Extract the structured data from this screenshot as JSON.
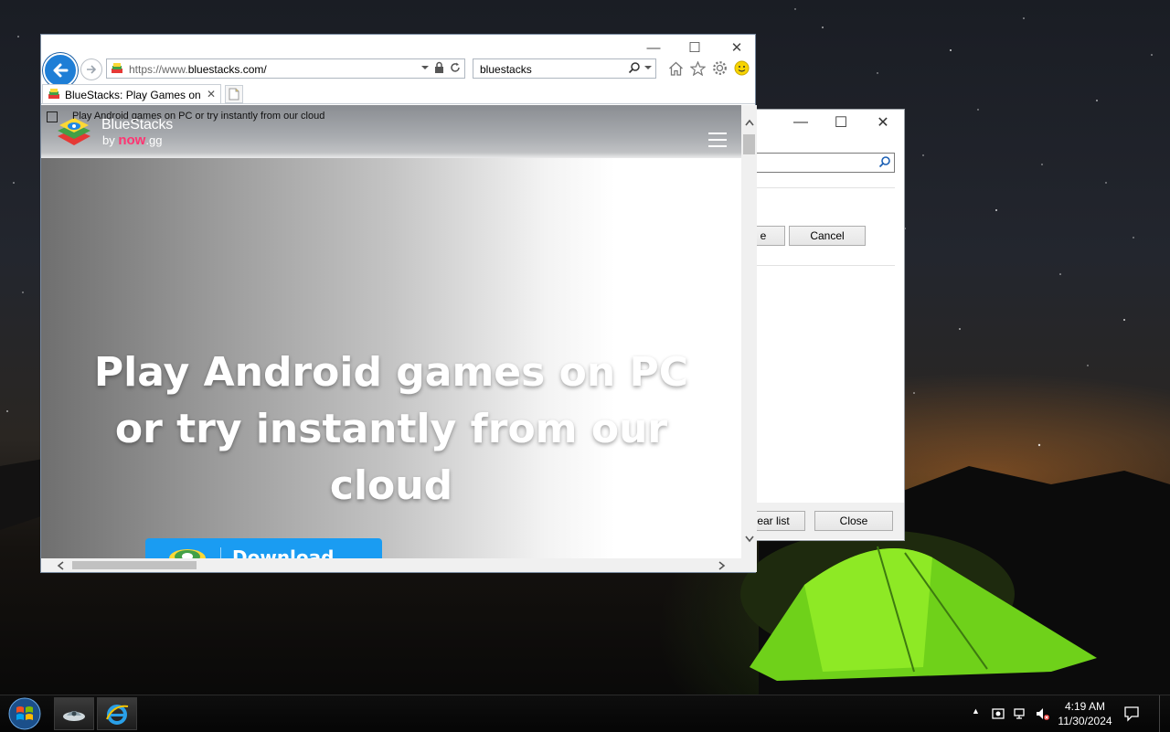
{
  "browser": {
    "url_prefix": "https://www.",
    "url_domain": "bluestacks.com/",
    "search_value": "bluestacks",
    "tab_title": "BlueStacks: Play Games on ...",
    "window_controls": {
      "minimize": "—",
      "maximize": "☐",
      "close": "✕"
    }
  },
  "page": {
    "broken_image_alt": "Play Android games on PC or try instantly from our cloud",
    "logo_name": "BlueStacks",
    "logo_by": "by",
    "logo_now": "now",
    "logo_gg": ".gg",
    "hero_line1": "Play Android games on PC",
    "hero_line2": "or try instantly from our",
    "hero_line3": "cloud",
    "download_label": "Download"
  },
  "dialog": {
    "button_partial": "e",
    "cancel_label": "Cancel",
    "clear_list_partial": "ear list",
    "close_label": "Close",
    "window_controls": {
      "minimize": "—",
      "maximize": "☐",
      "close": "✕"
    }
  },
  "taskbar": {
    "time": "4:19 AM",
    "date": "11/30/2024",
    "tray_arrow": "▲"
  },
  "colors": {
    "ie_blue": "#1e7ed6",
    "download_button": "#1a9cf2",
    "now_pink": "#ff3572"
  },
  "icons": [
    "back-icon",
    "forward-icon",
    "lock-icon",
    "refresh-icon",
    "search-icon",
    "home-icon",
    "favorites-star-icon",
    "settings-gear-icon",
    "feedback-smiley-icon",
    "hamburger-icon",
    "windows-start-icon",
    "internet-explorer-icon"
  ]
}
